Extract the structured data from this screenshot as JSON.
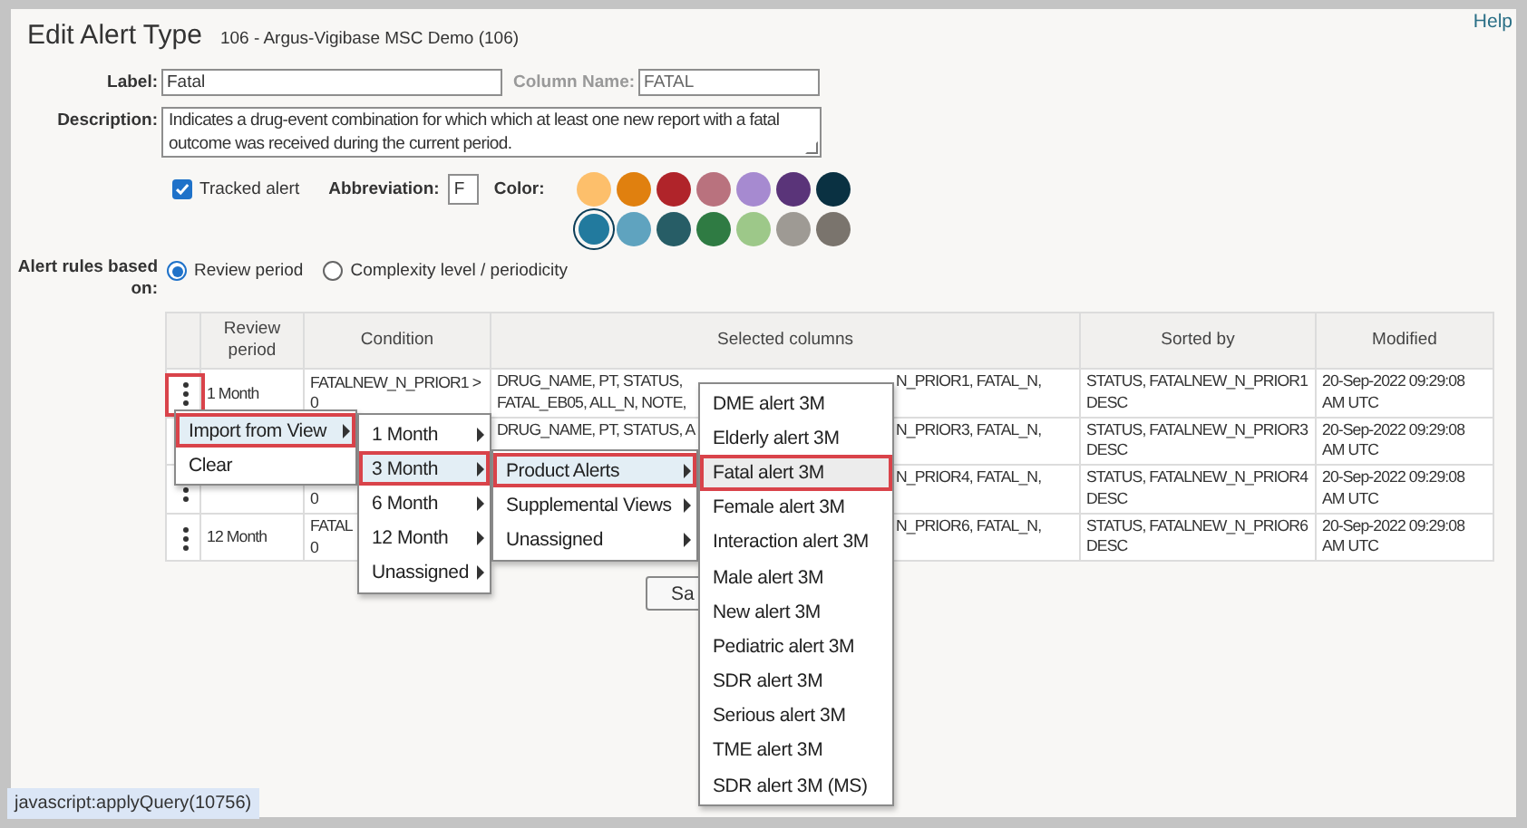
{
  "dialog": {
    "title": "Edit Alert Type",
    "subtitle": "106 - Argus-Vigibase MSC Demo (106)",
    "help_link": "Help"
  },
  "form": {
    "label": {
      "caption": "Label:",
      "value": "Fatal"
    },
    "column_name": {
      "caption": "Column Name:",
      "value": "FATAL",
      "disabled": true
    },
    "description": {
      "caption": "Description:",
      "value": "Indicates a drug-event combination for which which at least one new report with a fatal outcome was received during the current period."
    },
    "tracked_alert": {
      "label": "Tracked alert",
      "checked": true
    },
    "abbreviation": {
      "caption": "Abbreviation:",
      "value": "F"
    },
    "color": {
      "caption": "Color:",
      "swatches": [
        {
          "color": "#fdbf6b",
          "selected": false
        },
        {
          "color": "#e0800f",
          "selected": false
        },
        {
          "color": "#b0242a",
          "selected": false
        },
        {
          "color": "#b9727e",
          "selected": false
        },
        {
          "color": "#a68ad0",
          "selected": false
        },
        {
          "color": "#5a3479",
          "selected": false
        },
        {
          "color": "#0a3142",
          "selected": false
        },
        {
          "color": "#227a9e",
          "selected": true
        },
        {
          "color": "#5fa3bf",
          "selected": false
        },
        {
          "color": "#275d66",
          "selected": false
        },
        {
          "color": "#2f7b43",
          "selected": false
        },
        {
          "color": "#9dc889",
          "selected": false
        },
        {
          "color": "#9e9a94",
          "selected": false
        },
        {
          "color": "#7a746d",
          "selected": false
        }
      ]
    },
    "alert_rules": {
      "caption": "Alert rules based on:",
      "options": [
        {
          "label": "Review period",
          "selected": true
        },
        {
          "label": "Complexity level / periodicity",
          "selected": false
        }
      ]
    }
  },
  "table": {
    "columns": [
      "Review period",
      "Condition",
      "Selected columns",
      "Sorted by",
      "Modified"
    ],
    "rows": [
      {
        "actions_highlighted": true,
        "review_period": "1 Month",
        "condition": [
          "FATALNEW_N_PRIOR1 >",
          "0"
        ],
        "selected_columns": {
          "left": [
            "DRUG_NAME, PT, STATUS,",
            "FATAL_EB05, ALL_N, NOTE,"
          ],
          "right": [
            "N_PRIOR1, FATAL_N,"
          ]
        },
        "sorted_by": "STATUS, FATALNEW_N_PRIOR1 DESC",
        "modified": "20-Sep-2022 09:29:08 AM UTC"
      },
      {
        "actions_highlighted": false,
        "selected_columns": {
          "left": [
            "DRUG_NAME, PT, STATUS, A"
          ],
          "right": [
            "N_PRIOR3, FATAL_N,"
          ]
        },
        "sorted_by": "STATUS, FATALNEW_N_PRIOR3 DESC",
        "modified": "20-Sep-2022 09:29:08 AM UTC"
      },
      {
        "actions_highlighted": false,
        "condition": [
          "0"
        ],
        "selected_columns": {
          "right": [
            "N_PRIOR4, FATAL_N,"
          ]
        },
        "sorted_by": "STATUS, FATALNEW_N_PRIOR4 DESC",
        "modified": "20-Sep-2022 09:29:08 AM UTC"
      },
      {
        "actions_highlighted": false,
        "review_period": "12 Month",
        "condition": [
          "FATAL",
          "0"
        ],
        "selected_columns": {
          "right": [
            "N_PRIOR6, FATAL_N,"
          ]
        },
        "sorted_by": "STATUS, FATALNEW_N_PRIOR6 DESC",
        "modified": "20-Sep-2022 09:29:08 AM UTC"
      }
    ]
  },
  "save_button": "Sa",
  "menus": [
    {
      "items": [
        {
          "label": "Import from View",
          "submenu": true,
          "selected": true
        },
        {
          "label": "Clear",
          "submenu": false,
          "selected": false
        }
      ]
    },
    {
      "items": [
        {
          "label": "1 Month",
          "submenu": true,
          "selected": false
        },
        {
          "label": "3 Month",
          "submenu": true,
          "selected": true
        },
        {
          "label": "6 Month",
          "submenu": true,
          "selected": false
        },
        {
          "label": "12 Month",
          "submenu": true,
          "selected": false
        },
        {
          "label": "Unassigned",
          "submenu": true,
          "selected": false
        }
      ]
    },
    {
      "items": [
        {
          "label": "Product Alerts",
          "submenu": true,
          "selected": true
        },
        {
          "label": "Supplemental Views",
          "submenu": true,
          "selected": false
        },
        {
          "label": "Unassigned",
          "submenu": true,
          "selected": false
        }
      ]
    },
    {
      "items": [
        {
          "label": "DME alert 3M",
          "submenu": false,
          "selected": false
        },
        {
          "label": "Elderly alert 3M",
          "submenu": false,
          "selected": false
        },
        {
          "label": "Fatal alert 3M",
          "submenu": false,
          "selected": true
        },
        {
          "label": "Female alert 3M",
          "submenu": false,
          "selected": false
        },
        {
          "label": "Interaction alert 3M",
          "submenu": false,
          "selected": false
        },
        {
          "label": "Male alert 3M",
          "submenu": false,
          "selected": false
        },
        {
          "label": "New alert 3M",
          "submenu": false,
          "selected": false
        },
        {
          "label": "Pediatric alert 3M",
          "submenu": false,
          "selected": false
        },
        {
          "label": "SDR alert 3M",
          "submenu": false,
          "selected": false
        },
        {
          "label": "Serious alert 3M",
          "submenu": false,
          "selected": false
        },
        {
          "label": "TME alert 3M",
          "submenu": false,
          "selected": false
        },
        {
          "label": "SDR alert 3M (MS)",
          "submenu": false,
          "selected": false
        }
      ]
    }
  ],
  "status_link": "javascript:applyQuery(10756)"
}
